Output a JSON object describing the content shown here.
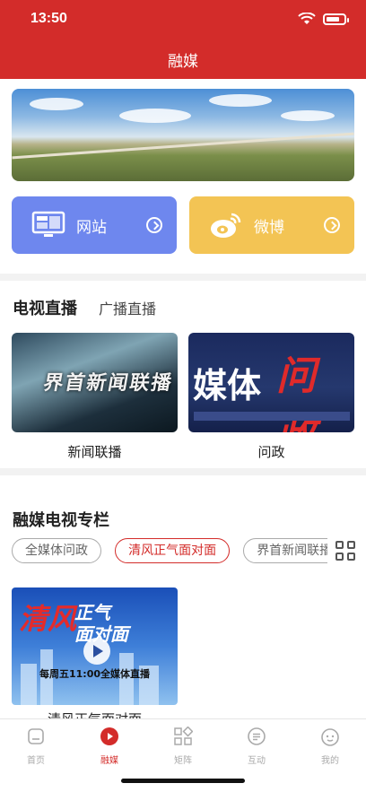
{
  "status_bar": {
    "time": "13:50",
    "wifi_icon": "wifi-icon",
    "battery_icon": "battery-icon"
  },
  "header": {
    "title": "融媒",
    "background": "#d32c2a"
  },
  "quick_links": [
    {
      "label": "网站",
      "icon": "monitor-icon",
      "color": "#6e87ee"
    },
    {
      "label": "微博",
      "icon": "weibo-icon",
      "color": "#f3c454"
    }
  ],
  "live": {
    "tabs": [
      "电视直播",
      "广播直播"
    ],
    "items": [
      {
        "caption": "新闻联播",
        "logo_text": "界首新闻联播"
      },
      {
        "caption": "问政",
        "logo_text_1": "媒体",
        "logo_text_2": "问政"
      }
    ]
  },
  "columns": {
    "title": "融媒电视专栏",
    "chips": [
      "全媒体问政",
      "清风正气面对面",
      "界首新闻联播"
    ],
    "active_chip": 1,
    "promo": {
      "q1": "清风",
      "q2": "正气",
      "q3": "面对面",
      "schedule": "每周五11:00全媒体直播",
      "caption": "清风正气面对面"
    }
  },
  "bottom_nav": {
    "items": [
      {
        "label": "首页",
        "icon": "home-icon"
      },
      {
        "label": "融媒",
        "icon": "play-circle-icon"
      },
      {
        "label": "矩阵",
        "icon": "matrix-icon"
      },
      {
        "label": "互动",
        "icon": "chat-icon"
      },
      {
        "label": "我的",
        "icon": "profile-icon"
      }
    ],
    "active": 1,
    "active_color": "#d32c2a"
  }
}
